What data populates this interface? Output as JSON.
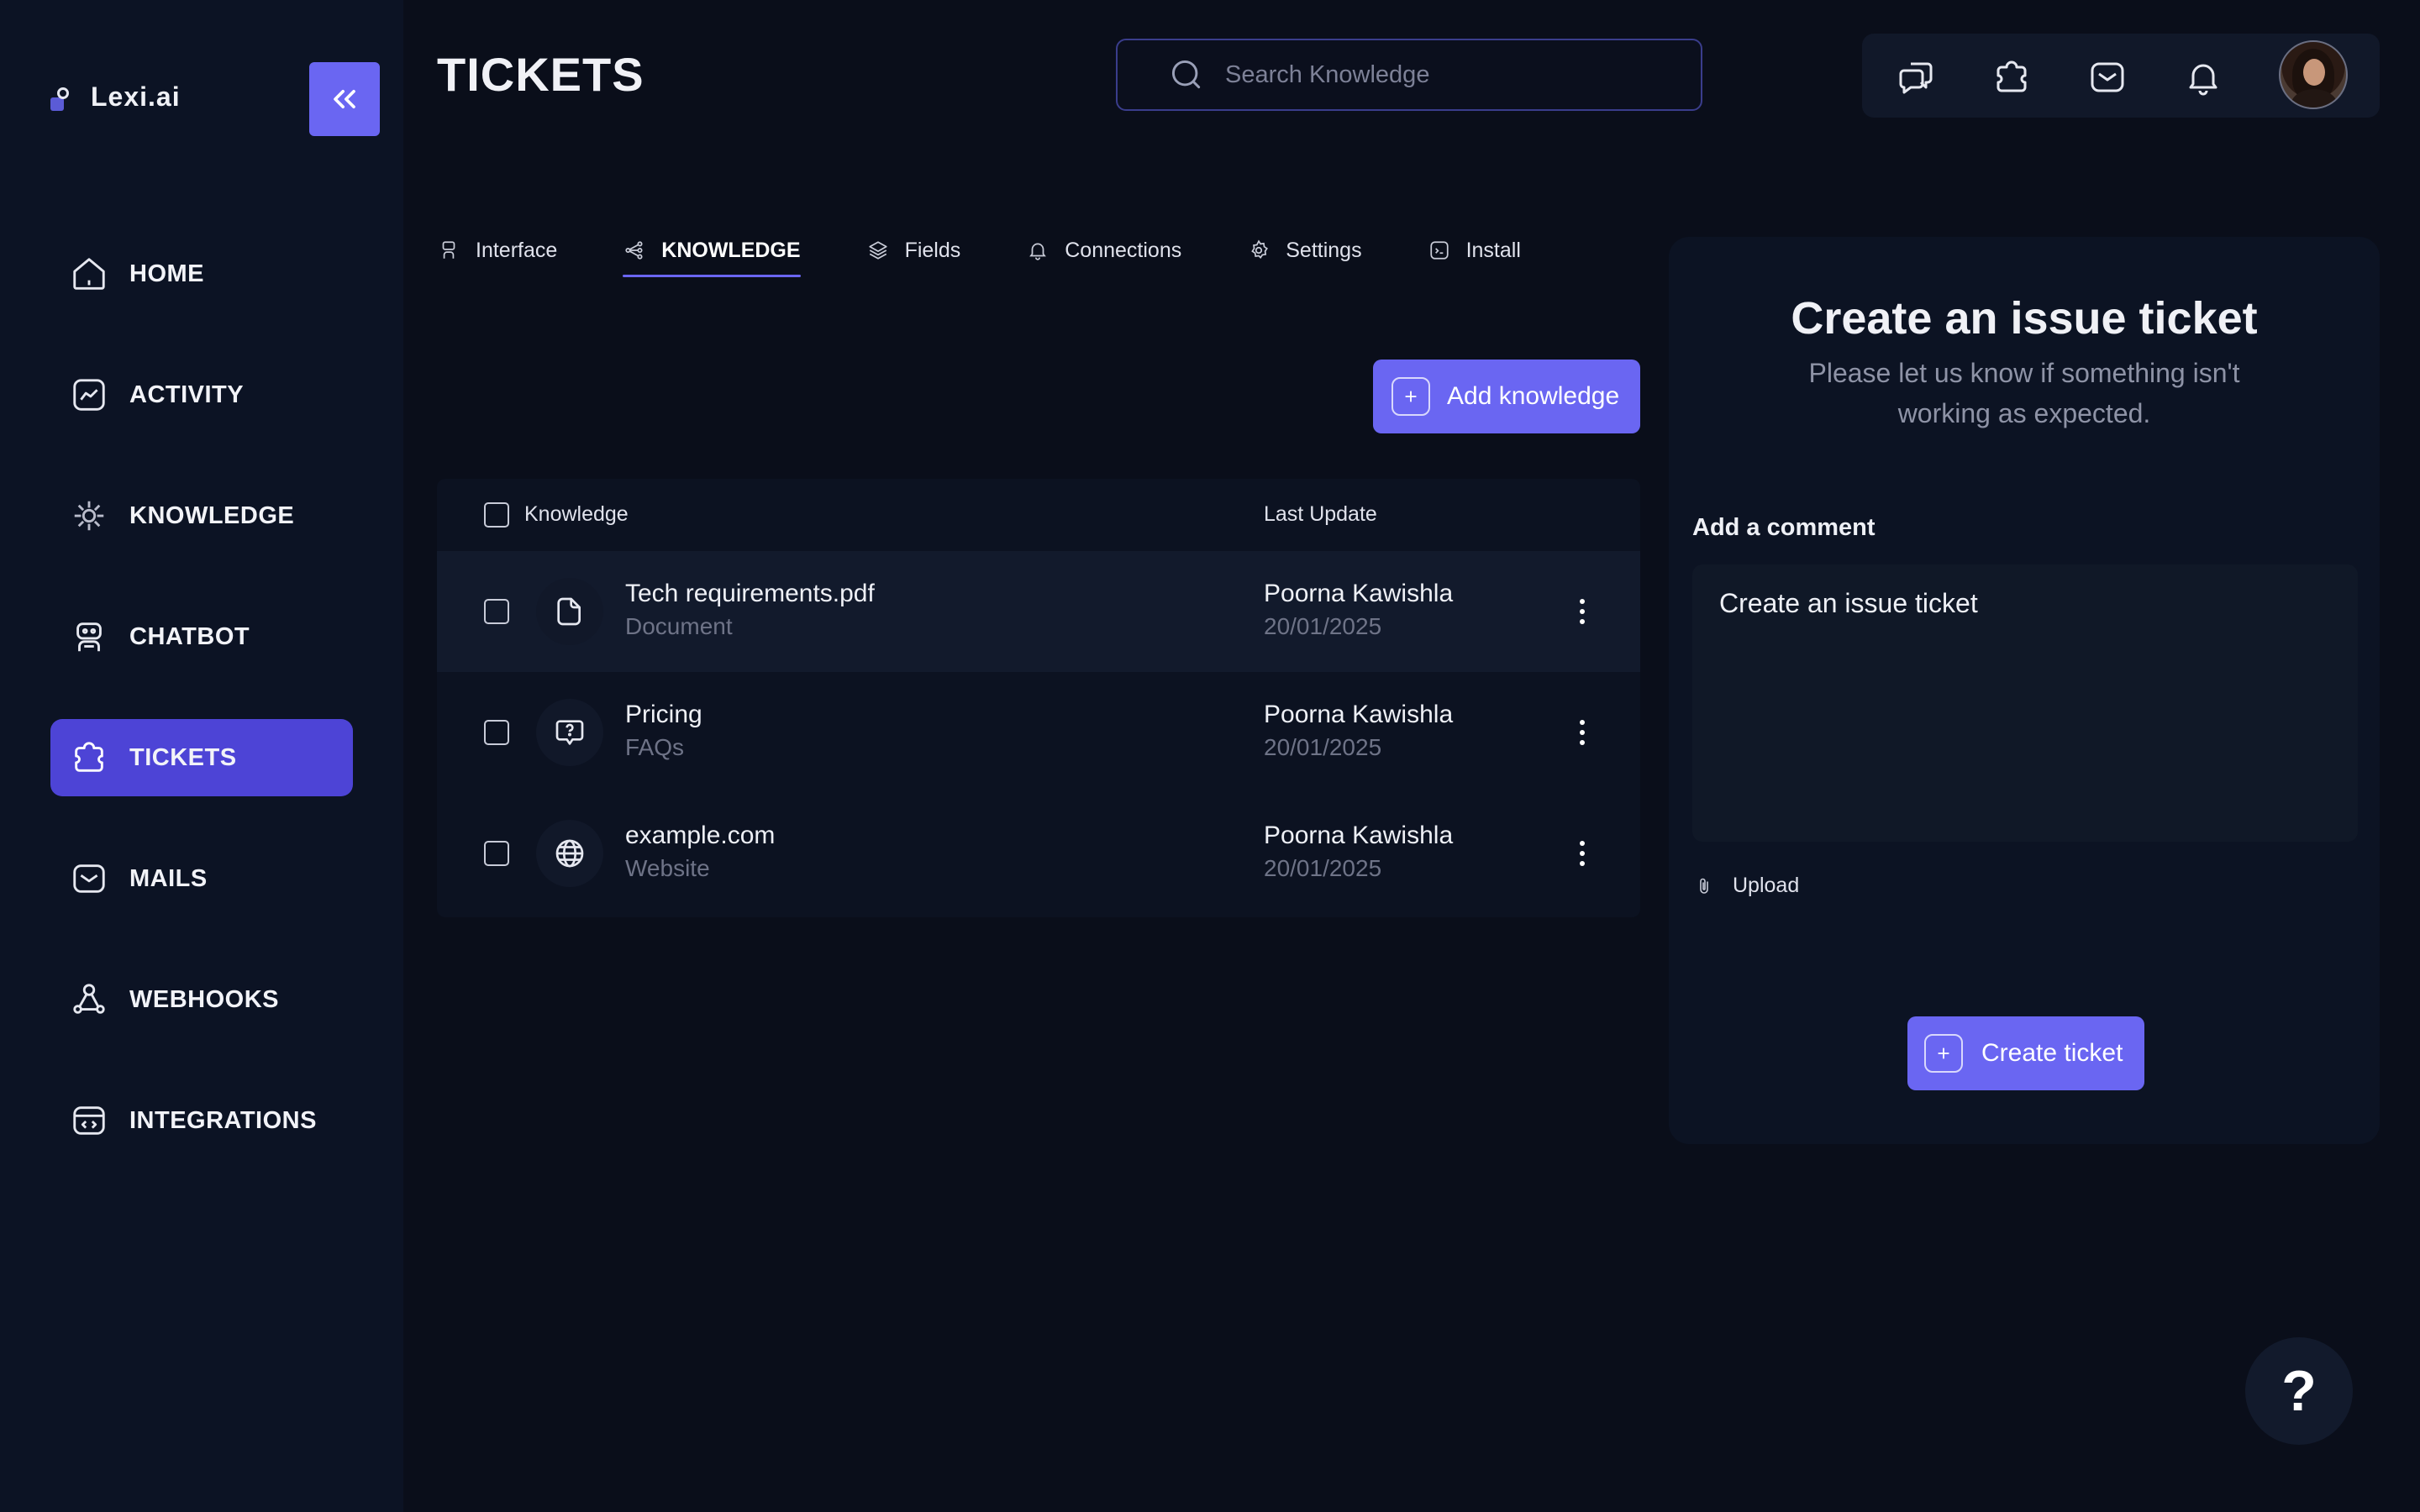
{
  "app": {
    "name": "Lexi.ai"
  },
  "sidebar": {
    "items": [
      {
        "label": "HOME",
        "icon": "home-icon"
      },
      {
        "label": "ACTIVITY",
        "icon": "activity-icon"
      },
      {
        "label": "KNOWLEDGE",
        "icon": "knowledge-icon"
      },
      {
        "label": "CHATBOT",
        "icon": "chatbot-icon"
      },
      {
        "label": "TICKETS",
        "icon": "tickets-icon",
        "active": true
      },
      {
        "label": "MAILS",
        "icon": "mail-icon"
      },
      {
        "label": "WEBHOOKS",
        "icon": "webhooks-icon"
      },
      {
        "label": "INTEGRATIONS",
        "icon": "integrations-icon"
      }
    ]
  },
  "header": {
    "title": "TICKETS",
    "search_placeholder": "Search Knowledge"
  },
  "tabs": [
    {
      "label": "Interface",
      "icon": "interface-icon"
    },
    {
      "label": "KNOWLEDGE",
      "icon": "share-nodes-icon",
      "active": true
    },
    {
      "label": "Fields",
      "icon": "layers-icon"
    },
    {
      "label": "Connections",
      "icon": "connections-icon"
    },
    {
      "label": "Settings",
      "icon": "settings-icon"
    },
    {
      "label": "Install",
      "icon": "install-icon"
    }
  ],
  "knowledge": {
    "add_label": "Add knowledge",
    "columns": {
      "knowledge": "Knowledge",
      "last_update": "Last Update"
    },
    "rows": [
      {
        "name": "Tech requirements.pdf",
        "type": "Document",
        "user": "Poorna Kawishla",
        "date": "20/01/2025",
        "icon": "document-icon"
      },
      {
        "name": "Pricing",
        "type": "FAQs",
        "user": "Poorna Kawishla",
        "date": "20/01/2025",
        "icon": "faq-icon"
      },
      {
        "name": "example.com",
        "type": "Website",
        "user": "Poorna Kawishla",
        "date": "20/01/2025",
        "icon": "globe-icon"
      }
    ]
  },
  "ticket": {
    "title": "Create an issue ticket",
    "subtitle": "Please let us know if something isn't working as expected.",
    "comment_label": "Add a comment",
    "comment_value": "Create an issue ticket",
    "upload_label": "Upload",
    "create_label": "Create ticket"
  },
  "help": {
    "label": "?"
  },
  "colors": {
    "accent": "#6a66f2",
    "active_nav": "#4d44d6",
    "background": "#0a0e1a"
  }
}
